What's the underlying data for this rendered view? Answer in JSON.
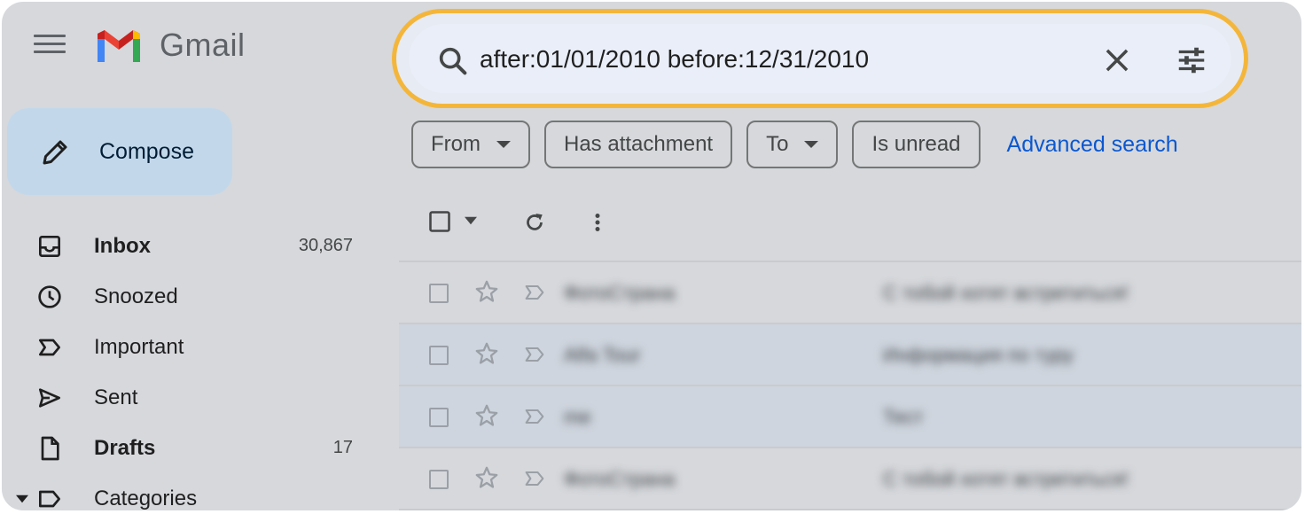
{
  "app": {
    "name": "Gmail",
    "brand_colors": {
      "red": "#ea4335",
      "blue": "#4285f4",
      "green": "#34a853",
      "yellow": "#fbbc04",
      "highlight": "#f4b63a"
    }
  },
  "header": {
    "menu_icon": "hamburger-menu-icon",
    "logo_text": "Gmail"
  },
  "search": {
    "query": "after:01/01/2010 before:12/31/2010",
    "icon": "search-icon",
    "clear_icon": "close-icon",
    "options_icon": "tune-icon"
  },
  "filters": {
    "chips": [
      {
        "label": "From",
        "has_dropdown": true
      },
      {
        "label": "Has attachment",
        "has_dropdown": false
      },
      {
        "label": "To",
        "has_dropdown": true
      },
      {
        "label": "Is unread",
        "has_dropdown": false
      }
    ],
    "advanced_search": "Advanced search"
  },
  "sidebar": {
    "compose_label": "Compose",
    "items": [
      {
        "label": "Inbox",
        "count": "30,867",
        "icon": "inbox-icon",
        "bold": true
      },
      {
        "label": "Snoozed",
        "count": "",
        "icon": "clock-icon",
        "bold": false
      },
      {
        "label": "Important",
        "count": "",
        "icon": "important-icon",
        "bold": false
      },
      {
        "label": "Sent",
        "count": "",
        "icon": "send-icon",
        "bold": false
      },
      {
        "label": "Drafts",
        "count": "17",
        "icon": "draft-icon",
        "bold": true
      },
      {
        "label": "Categories",
        "count": "",
        "icon": "label-icon",
        "bold": false
      }
    ]
  },
  "toolbar": {
    "select_icon": "checkbox-icon",
    "select_menu_icon": "caret-down-icon",
    "refresh_icon": "refresh-icon",
    "more_icon": "more-vert-icon"
  },
  "messages": [
    {
      "sender": "ФотоСтрана",
      "subject": "С тобой хотят встретиться!"
    },
    {
      "sender": "Alfa Tour",
      "subject": "Информация по туру"
    },
    {
      "sender": "me",
      "subject": "Тест"
    },
    {
      "sender": "ФотоСтрана",
      "subject": "С тобой хотят встретиться!"
    }
  ]
}
